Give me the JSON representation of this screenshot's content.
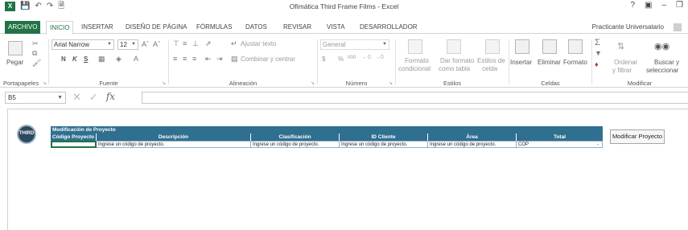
{
  "app": {
    "window_title": "Ofimática Third Frame Films - Excel",
    "account": "Practicante Universatario",
    "tabs": [
      "ARCHIVO",
      "INICIO",
      "INSERTAR",
      "DISEÑO DE PÁGINA",
      "FÓRMULAS",
      "DATOS",
      "REVISAR",
      "VISTA",
      "DESARROLLADOR"
    ],
    "active_tab": "INICIO"
  },
  "ribbon": {
    "clipboard": {
      "paste": "Pegar",
      "label": "Portapapeles"
    },
    "font": {
      "name": "Arial Narrow",
      "size": "12",
      "bold": "N",
      "italic": "K",
      "underline": "S",
      "label": "Fuente"
    },
    "alignment": {
      "wrap": "Ajustar texto",
      "merge": "Combinar y centrar",
      "label": "Alineación"
    },
    "number": {
      "format": "General",
      "currency": "$",
      "percent": "%",
      "thousands": "000",
      "label": "Número"
    },
    "styles": {
      "conditional_1": "Formato",
      "conditional_2": "condicional",
      "table_1": "Dar formato",
      "table_2": "como tabla",
      "cell_1": "Estilos de",
      "cell_2": "celda",
      "label": "Estilos"
    },
    "cells": {
      "insert": "Insertar",
      "delete": "Eliminar",
      "format": "Formato",
      "label": "Celdas"
    },
    "modify": {
      "sort_1": "Ordenar",
      "sort_2": "y filtrar",
      "find_1": "Buscar y",
      "find_2": "seleccionar",
      "label": "Modificar"
    }
  },
  "formula_bar": {
    "name_box": "B5",
    "fx": "fx",
    "formula": ""
  },
  "form": {
    "logo_text": "THIRD",
    "title": "Modificación de Proyecto",
    "columns": [
      "Código Proyecto",
      "Descripción",
      "Clasificación",
      "ID Cliente",
      "Área",
      "Total"
    ],
    "row": [
      "",
      "Ingrese un  código de proyecto.",
      "Ingrese un  código de proyecto.",
      "Ingrese un  código de proyecto.",
      "Ingrese un  código de proyecto.",
      "COP"
    ],
    "total_suffix": "-",
    "button": "Modificar Proyecto"
  }
}
